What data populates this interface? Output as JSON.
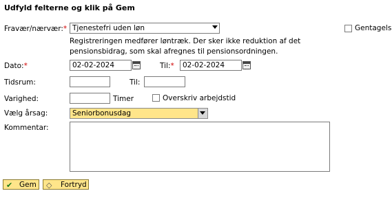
{
  "form": {
    "title": "Udfyld felterne og klik på Gem",
    "absence_label": "Fravær/nærvær:",
    "required_mark": "*",
    "absence_value": "Tjenestefri uden løn",
    "repeat_label": "Gentagelse",
    "info_line1": "Registreringen medfører løntræk. Der sker ikke reduktion af det",
    "info_line2": "pensionsbidrag, som skal afregnes til pensionsordningen.",
    "date_label": "Dato:",
    "date_value": "02-02-2024",
    "to_label": "Til:",
    "to_date_value": "02-02-2024",
    "time_label": "Tidsrum:",
    "time_from_value": "",
    "time_to_label": "Til:",
    "time_to_value": "",
    "duration_label": "Varighed:",
    "duration_value": "",
    "hours_label": "Timer",
    "override_label": "Overskriv arbejdstid",
    "reason_label": "Vælg årsag:",
    "reason_value": "Seniorbonusdag",
    "comment_label": "Kommentar:",
    "comment_value": ""
  },
  "buttons": {
    "save_label": "Gem",
    "cancel_label": "Fortryd"
  },
  "colors": {
    "accent_yellow": "#ffe58a",
    "required_red": "#d00000"
  }
}
